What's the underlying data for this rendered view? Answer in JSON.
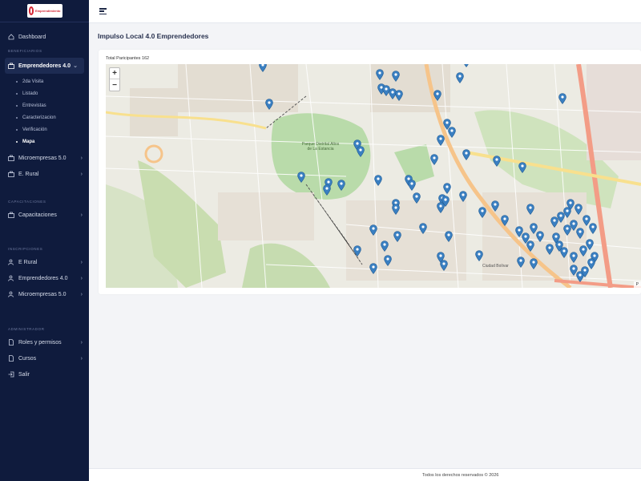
{
  "sidebar": {
    "logo_text": "Emprendimiento",
    "dashboard": "Dashboard",
    "sections": {
      "beneficiarios": "Beneficiarios",
      "capacitaciones": "Capacitaciones",
      "inscripciones": "Inscripciones",
      "administrador": "Administrador"
    },
    "emprendedores_group": {
      "label": "Emprendedores 4.0",
      "items": [
        "2da Visita",
        "Listado",
        "Entrevistas",
        "Caracterizacion",
        "Verificación",
        "Mapa"
      ]
    },
    "microempresas": "Microempresas 5.0",
    "erural": "E. Rural",
    "capacitaciones_item": "Capacitaciones",
    "insc_erural": "E Rural",
    "insc_emprendedores": "Emprendedores 4.0",
    "insc_microempresas": "Microempresas 5.0",
    "roles": "Roles y permisos",
    "cursos": "Cursos",
    "salir": "Salir"
  },
  "page": {
    "title": "Impulso Local 4.0 Emprendedores",
    "participants_label": "Total Paricipantes 162"
  },
  "map": {
    "zoom_in": "+",
    "zoom_out": "−",
    "attribution": "P",
    "park_label": "Parque Distrital Altos de La Estancia",
    "district_label": "Ciudad Bolívar",
    "marker_color": "#3a7fc1"
  },
  "footer": {
    "text": "Todos los derechos reservados © 2026"
  }
}
